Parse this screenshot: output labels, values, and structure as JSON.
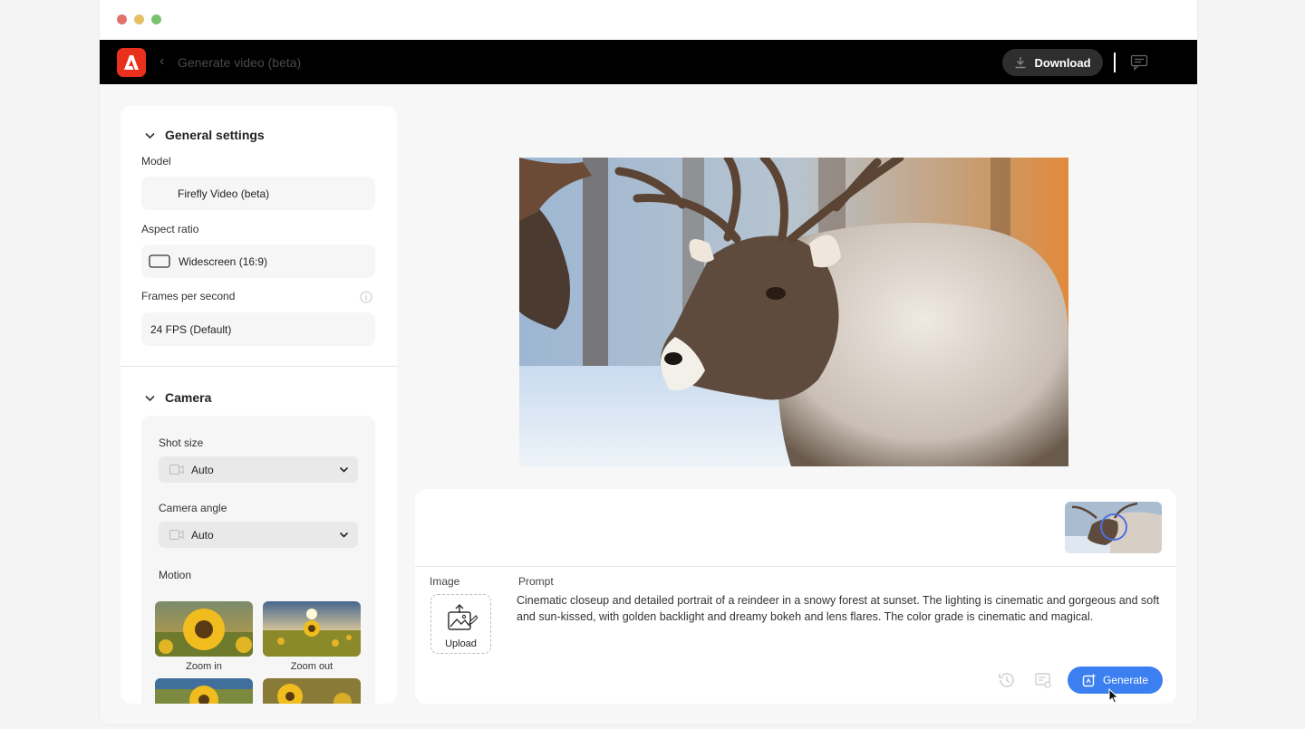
{
  "header": {
    "app_title": "Generate video (beta)",
    "download_label": "Download"
  },
  "sidebar": {
    "general": {
      "heading": "General settings",
      "model_label": "Model",
      "model_value": "Firefly Video (beta)",
      "aspect_label": "Aspect ratio",
      "aspect_value": "Widescreen (16:9)",
      "fps_label": "Frames per second",
      "fps_value": "24 FPS (Default)"
    },
    "camera": {
      "heading": "Camera",
      "shot_label": "Shot size",
      "shot_value": "Auto",
      "angle_label": "Camera angle",
      "angle_value": "Auto",
      "motion_label": "Motion",
      "motion_options": [
        "Zoom in",
        "Zoom out"
      ]
    }
  },
  "composer": {
    "image_label": "Image",
    "upload_label": "Upload",
    "prompt_label": "Prompt",
    "prompt_text": "Cinematic closeup and detailed portrait of a reindeer in a snowy forest at sunset. The lighting is cinematic and gorgeous and soft and sun-kissed, with golden backlight and dreamy bokeh and lens flares. The color grade is cinematic and magical.",
    "generate_label": "Generate"
  },
  "colors": {
    "adobe_red": "#e8301c",
    "accent_blue": "#3b7ff0",
    "appbar_bg": "#000000"
  }
}
